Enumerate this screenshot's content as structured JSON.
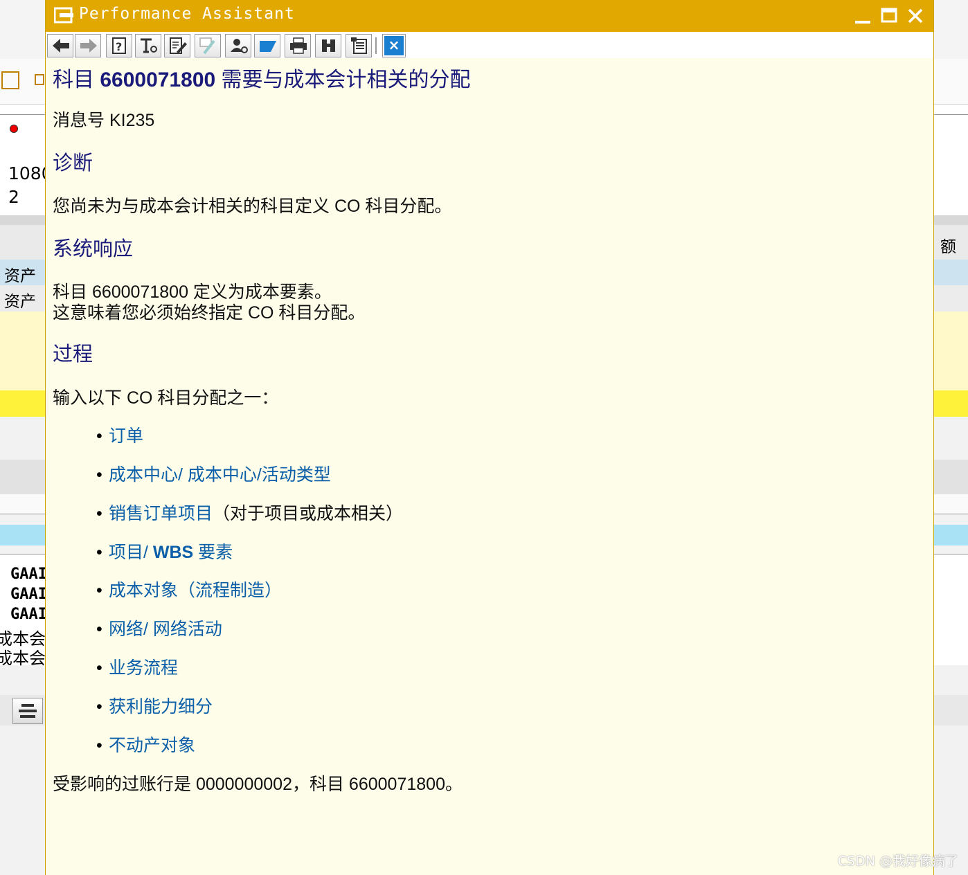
{
  "background": {
    "left_fragments": [
      "1080",
      "2",
      "资产",
      "资产",
      "GAAI",
      "GAAI",
      "GAAI",
      "成本会",
      "成本会"
    ],
    "right_fragment": "额"
  },
  "popup": {
    "title": "Performance Assistant",
    "toolbar_icons": [
      "back-icon",
      "forward-icon",
      "help-icon",
      "technical-info-icon",
      "edit-icon",
      "highlight-icon",
      "user-icon",
      "flag-icon",
      "print-icon",
      "find-icon",
      "copy-icon",
      "document-icon",
      "close-icon"
    ],
    "close_glyph": "×",
    "heading_pre": "科目 ",
    "heading_num": "6600071800",
    "heading_post": " 需要与成本会计相关的分配",
    "message_no": "消息号 KI235",
    "diagnosis_title": "诊断",
    "diagnosis_text": "您尚未为与成本会计相关的科目定义 CO 科目分配。",
    "response_title": "系统响应",
    "response_line1": "科目 6600071800 定义为成本要素。",
    "response_line2": "这意味着您必须始终指定 CO 科目分配。",
    "procedure_title": "过程",
    "procedure_intro": "输入以下 CO 科目分配之一：",
    "bullets": [
      {
        "link": "订单",
        "rest": ""
      },
      {
        "link": "成本中心/ 成本中心/活动类型",
        "rest": ""
      },
      {
        "link": "销售订单项目",
        "rest": "（对于项目或成本相关）"
      },
      {
        "link": "项目/ ",
        "bold": "WBS",
        "link2": " 要素",
        "rest": ""
      },
      {
        "link": "成本对象（流程制造）",
        "rest": ""
      },
      {
        "link": "网络/ 网络活动",
        "rest": ""
      },
      {
        "link": "业务流程",
        "rest": ""
      },
      {
        "link": "获利能力细分",
        "rest": ""
      },
      {
        "link": "不动产对象",
        "rest": ""
      }
    ],
    "bullet_glyph": "•",
    "affected_line": "受影响的过账行是 0000000002，科目 6600071800。"
  },
  "watermark": "CSDN @我好像病了",
  "colors": {
    "titlebar": "#e0a800",
    "content_bg": "#fefde9",
    "heading": "#1a1a7a",
    "link": "#0b5ea8"
  }
}
